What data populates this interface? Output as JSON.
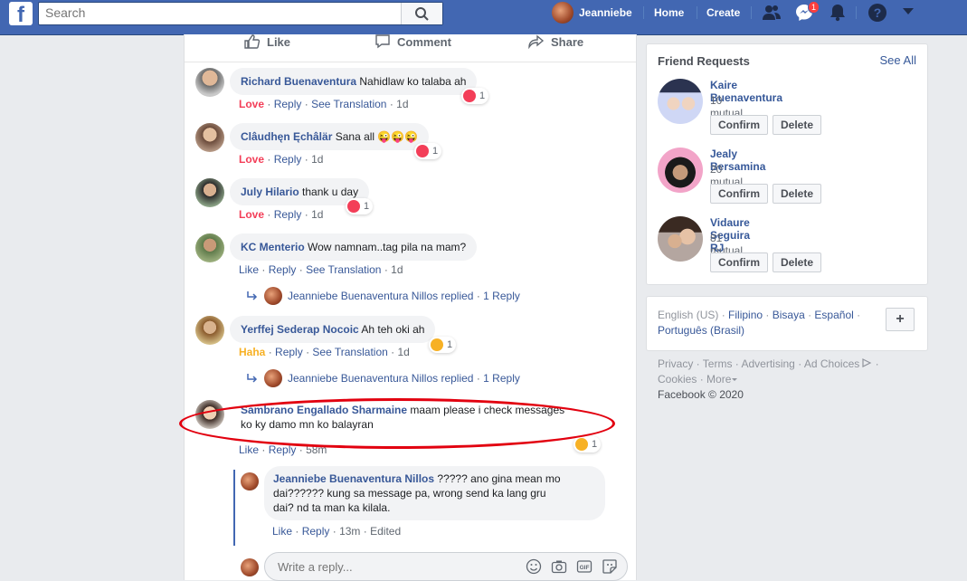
{
  "topbar": {
    "search_placeholder": "Search",
    "user_name": "Jeanniebe",
    "home": "Home",
    "create": "Create",
    "messenger_badge": "1"
  },
  "post_actions": {
    "like": "Like",
    "comment": "Comment",
    "share": "Share"
  },
  "comments": [
    {
      "name": "Richard Buenaventura",
      "text": "Nahidlaw ko talaba ah",
      "reaction": "Love",
      "reply": "Reply",
      "translate": "See Translation",
      "time": "1d",
      "react_count": "1",
      "react_type": "love"
    },
    {
      "name": "Clâudhęn Ęchâlär",
      "text": "Sana all 😜😜😜",
      "reaction": "Love",
      "reply": "Reply",
      "time": "1d",
      "react_count": "1",
      "react_type": "love"
    },
    {
      "name": "July Hilario",
      "text": "thank u day",
      "reaction": "Love",
      "reply": "Reply",
      "time": "1d",
      "react_count": "1",
      "react_type": "love"
    },
    {
      "name": "KC Menterio",
      "text": "Wow namnam..tag pila na mam?",
      "reaction": "Like",
      "reply": "Reply",
      "translate": "See Translation",
      "time": "1d",
      "replied_by": "Jeanniebe Buenaventura Nillos replied",
      "replies": "1 Reply"
    },
    {
      "name": "Yerffej Sederap Nocoic",
      "text": "Ah teh oki ah",
      "reaction": "Haha",
      "reply": "Reply",
      "translate": "See Translation",
      "time": "1d",
      "react_count": "1",
      "react_type": "haha",
      "replied_by": "Jeanniebe Buenaventura Nillos replied",
      "replies": "1 Reply"
    },
    {
      "name": "Sambrano Engallado Sharmaine",
      "text": "maam please i check messages",
      "text2": "ko ky damo mn ko balayran",
      "reaction": "Like",
      "reply": "Reply",
      "time": "58m",
      "react_count": "1",
      "react_type": "haha"
    }
  ],
  "nested_reply": {
    "name": "Jeanniebe Buenaventura Nillos",
    "line1": "????? ano gina mean mo",
    "line2": "dai?????? kung sa message pa, wrong send ka lang gru",
    "line3": "dai? nd ta man ka kilala.",
    "like": "Like",
    "reply": "Reply",
    "time": "13m",
    "edited": "Edited"
  },
  "reply_box": {
    "placeholder": "Write a reply..."
  },
  "friend_requests": {
    "title": "Friend Requests",
    "see_all": "See All",
    "confirm": "Confirm",
    "delete": "Delete",
    "items": [
      {
        "name": "Kaire Buenaventura",
        "mutual": "10 mutual friends"
      },
      {
        "name": "Jealy Bersamina",
        "mutual": "20 mutual friends"
      },
      {
        "name": "Vidaure Seguira RJ",
        "mutual": "81 mutual friends"
      }
    ]
  },
  "languages": {
    "current": "English (US)",
    "others": [
      "Filipino",
      "Bisaya",
      "Español",
      "Português (Brasil)"
    ],
    "add": "+"
  },
  "footer": {
    "links": [
      "Privacy",
      "Terms",
      "Advertising",
      "Ad Choices",
      "Cookies",
      "More"
    ],
    "copyright": "Facebook © 2020"
  },
  "colors": {
    "brand": "#4267b2",
    "link": "#385898",
    "love": "#f33e58",
    "haha": "#f7b125",
    "annotation": "#e2000f"
  }
}
